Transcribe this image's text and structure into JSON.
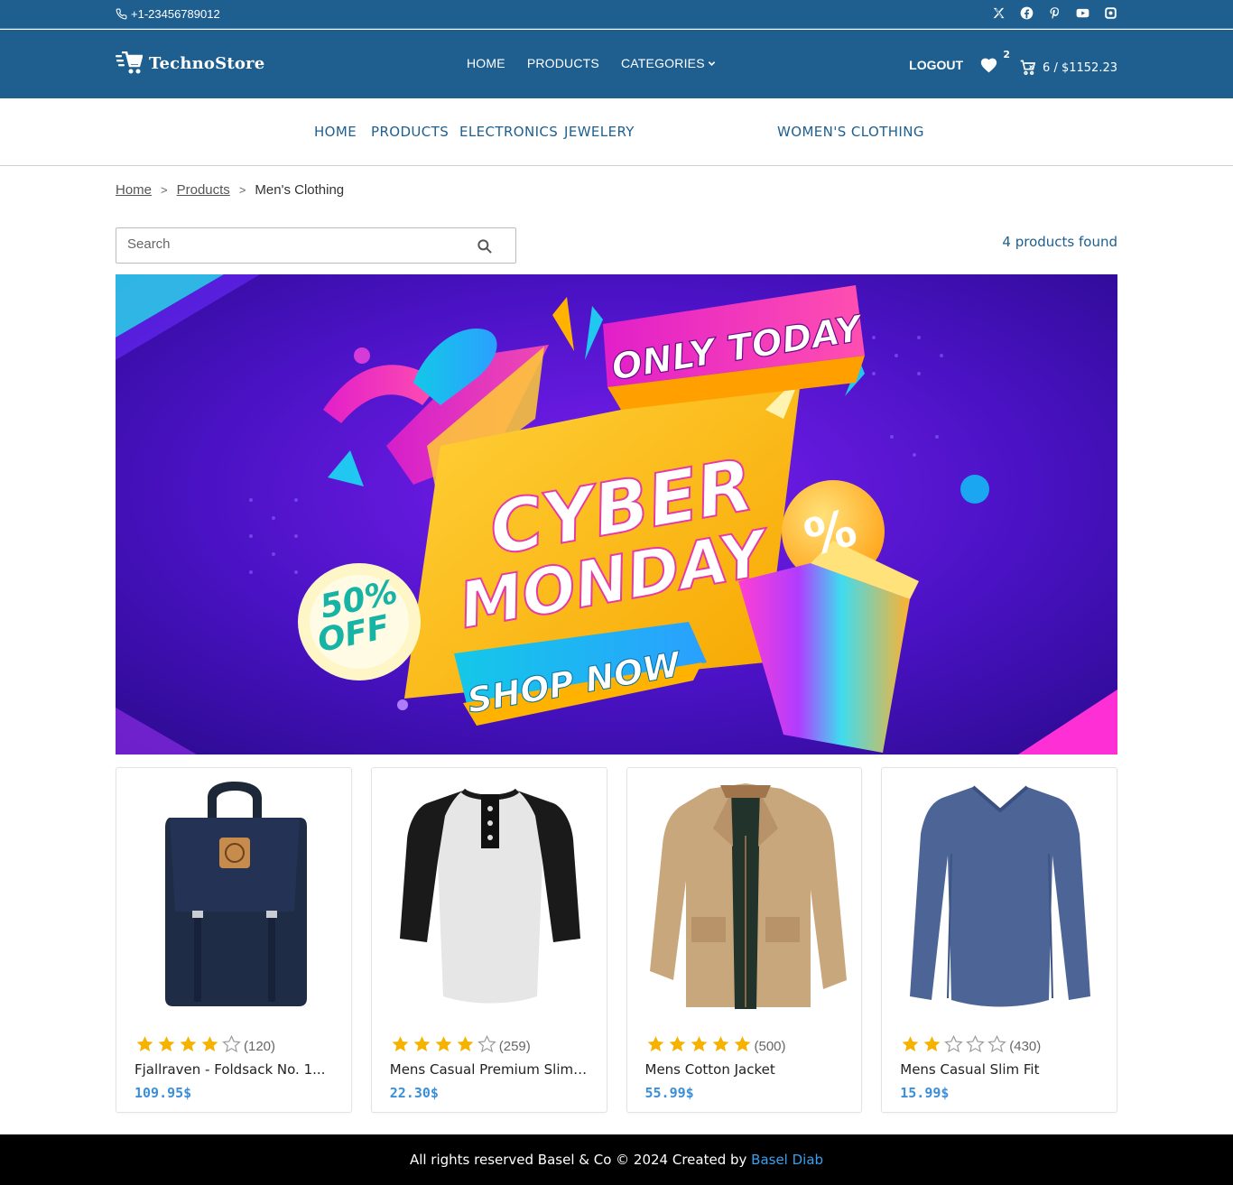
{
  "topbar": {
    "phone": "+1-23456789012",
    "socials": [
      "x-icon",
      "facebook-icon",
      "pinterest-icon",
      "youtube-icon",
      "instagram-icon"
    ]
  },
  "header": {
    "brand": "TechnoStore",
    "nav": [
      "HOME",
      "PRODUCTS",
      "CATEGORIES"
    ],
    "logout": "LOGOUT",
    "wishlist_count": "2",
    "cart_summary": "6 / $1152.23"
  },
  "category_nav": [
    "HOME",
    "PRODUCTS",
    "ELECTRONICS",
    "JEWELERY",
    "WOMEN'S CLOTHING"
  ],
  "breadcrumb": [
    "Home",
    "Products",
    "Men's Clothing"
  ],
  "search": {
    "placeholder": "Search"
  },
  "results": {
    "count_text": "4 products found"
  },
  "banner": {
    "only_today": "ONLY TODAY",
    "line1": "CYBER",
    "line2": "MONDAY",
    "discount_pct": "50%",
    "discount_off": "OFF",
    "cta": "SHOP NOW",
    "percent_symbol": "%"
  },
  "products": [
    {
      "title": "Fjallraven - Foldsack No. 1...",
      "rating": 4,
      "reviews": "(120)",
      "price": "109.95$"
    },
    {
      "title": "Mens Casual Premium Slim ...",
      "rating": 4,
      "reviews": "(259)",
      "price": "22.30$"
    },
    {
      "title": "Mens Cotton Jacket",
      "rating": 5,
      "reviews": "(500)",
      "price": "55.99$"
    },
    {
      "title": "Mens Casual Slim Fit",
      "rating": 2,
      "reviews": "(430)",
      "price": "15.99$"
    }
  ],
  "footer": {
    "text": "All rights reserved Basel & Co © 2024 Created by ",
    "author": "Basel Diab"
  },
  "colors": {
    "primary": "#1e5f8f",
    "price": "#3b8fd9",
    "star": "#f5b300",
    "footer": "#000000"
  }
}
